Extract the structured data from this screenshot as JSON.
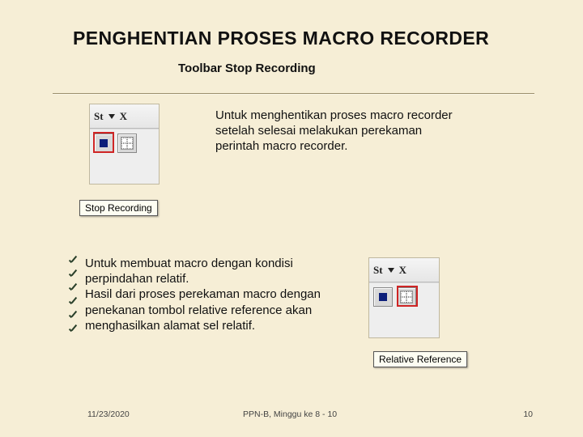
{
  "title": "PENGHENTIAN PROSES MACRO RECORDER",
  "subtitle": "Toolbar Stop Recording",
  "paraA": "Untuk menghentikan proses macro recorder setelah selesai melakukan perekaman perintah macro recorder.",
  "paraB": "Untuk membuat macro dengan kondisi perpindahan relatif.\nHasil dari proses perekaman macro dengan penekanan tombol relative reference akan menghasilkan alamat sel relatif.",
  "figure": {
    "headerLabel": "St",
    "headerX": "X",
    "tooltipStop": "Stop Recording",
    "tooltipRelRef": "Relative Reference"
  },
  "footer": {
    "date": "11/23/2020",
    "center": "PPN-B, Minggu ke 8 - 10",
    "page": "10"
  }
}
